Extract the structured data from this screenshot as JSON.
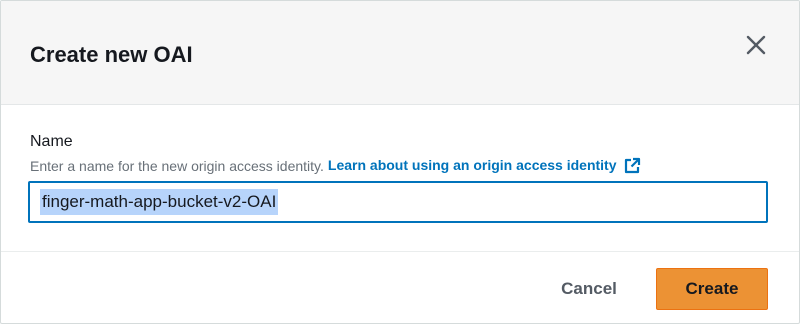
{
  "modal": {
    "title": "Create new OAI",
    "close_icon": "close-icon"
  },
  "form": {
    "name_label": "Name",
    "description": "Enter a name for the new origin access identity.",
    "learn_link": "Learn about using an origin access identity",
    "link_icon": "external-link-icon",
    "name_value": "finger-math-app-bucket-v2-OAI"
  },
  "footer": {
    "cancel_label": "Cancel",
    "create_label": "Create"
  },
  "colors": {
    "link": "#0073bb",
    "primary_button": "#ec9234",
    "input_focus_border": "#0073bb",
    "selection_highlight": "#b7d4fb",
    "header_background": "#f6f6f6"
  }
}
